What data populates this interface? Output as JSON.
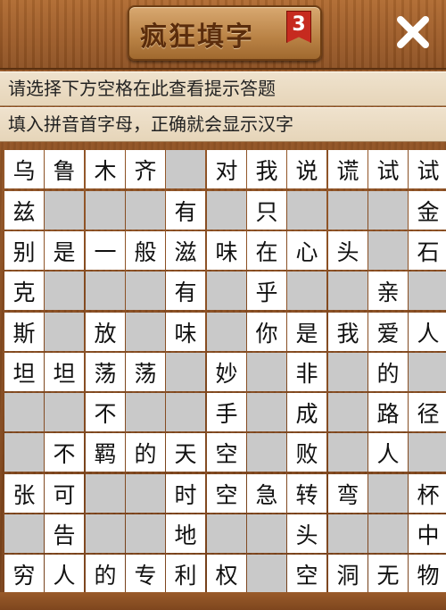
{
  "app": {
    "title": "疯狂填字",
    "level": "3"
  },
  "hints": {
    "line1": "请选择下方空格在此查看提示答题",
    "line2": "填入拼音首字母，正确就会显示汉字"
  },
  "icons": {
    "close": "close-x-icon"
  },
  "colors": {
    "wood": "#8b4f22",
    "badge": "#c62a1f",
    "empty_cell": "#c9c9c9",
    "filled_cell": "#ffffff"
  },
  "grid": {
    "rows": [
      [
        "乌",
        "鲁",
        "木",
        "齐",
        null,
        "对",
        "我",
        "说",
        "谎",
        "试",
        "试"
      ],
      [
        "兹",
        null,
        null,
        null,
        "有",
        null,
        "只",
        null,
        null,
        null,
        "金"
      ],
      [
        "别",
        "是",
        "一",
        "般",
        "滋",
        "味",
        "在",
        "心",
        "头",
        null,
        "石"
      ],
      [
        "克",
        null,
        null,
        null,
        "有",
        null,
        "乎",
        null,
        null,
        "亲",
        null
      ],
      [
        "斯",
        null,
        "放",
        null,
        "味",
        null,
        "你",
        "是",
        "我",
        "爱",
        "人"
      ],
      [
        "坦",
        "坦",
        "荡",
        "荡",
        null,
        "妙",
        null,
        "非",
        null,
        "的",
        null
      ],
      [
        null,
        null,
        "不",
        null,
        null,
        "手",
        null,
        "成",
        null,
        "路",
        "径"
      ],
      [
        null,
        "不",
        "羁",
        "的",
        "天",
        "空",
        null,
        "败",
        null,
        "人",
        null
      ],
      [
        "张",
        "可",
        null,
        null,
        "时",
        "空",
        "急",
        "转",
        "弯",
        null,
        "杯"
      ],
      [
        null,
        "告",
        null,
        null,
        "地",
        null,
        null,
        "头",
        null,
        null,
        "中"
      ],
      [
        "穷",
        "人",
        "的",
        "专",
        "利",
        "权",
        null,
        "空",
        "洞",
        "无",
        "物"
      ]
    ]
  }
}
